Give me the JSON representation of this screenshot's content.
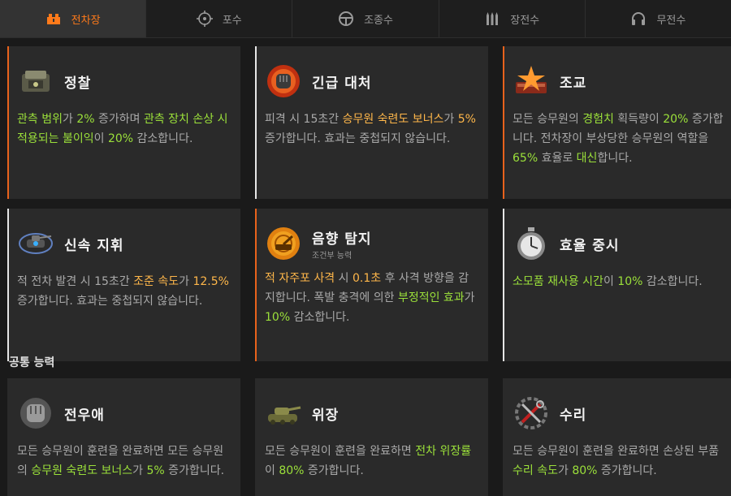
{
  "tabs": [
    {
      "label": "전차장",
      "icon": "commander-icon",
      "active": true
    },
    {
      "label": "포수",
      "icon": "crosshair-icon",
      "active": false
    },
    {
      "label": "조종수",
      "icon": "steering-wheel-icon",
      "active": false
    },
    {
      "label": "장전수",
      "icon": "shells-icon",
      "active": false
    },
    {
      "label": "무전수",
      "icon": "headset-icon",
      "active": false
    }
  ],
  "skills": [
    {
      "title": "정찰",
      "icon": "recon-icon",
      "desc": [
        [
          "관측 범위",
          "g"
        ],
        [
          "가 ",
          ""
        ],
        [
          "2%",
          "g"
        ],
        [
          " 증가하며 ",
          ""
        ],
        [
          "관측 장치 손상 시 적용되는 불이익",
          "g"
        ],
        [
          "이 ",
          ""
        ],
        [
          "20%",
          "g"
        ],
        [
          " 감소합니다.",
          ""
        ]
      ]
    },
    {
      "title": "긴급 대처",
      "icon": "emergency-fist-icon",
      "desc": [
        [
          "피격 시 15초간 ",
          ""
        ],
        [
          "승무원 숙련도 보너스",
          "o"
        ],
        [
          "가 ",
          ""
        ],
        [
          "5%",
          "o"
        ],
        [
          " 증가합니다. 효과는 중첩되지 않습니다.",
          ""
        ]
      ]
    },
    {
      "title": "조교",
      "icon": "mentor-star-icon",
      "desc": [
        [
          "모든 승무원의 ",
          ""
        ],
        [
          "경험치",
          "g"
        ],
        [
          " 획득량이 ",
          ""
        ],
        [
          "20%",
          "g"
        ],
        [
          " 증가합니다. 전차장이 부상당한 승무원의 역할을 ",
          ""
        ],
        [
          "65%",
          "g"
        ],
        [
          " 효율로 ",
          ""
        ],
        [
          "대신",
          "g"
        ],
        [
          "합니다.",
          ""
        ]
      ]
    },
    {
      "title": "신속 지휘",
      "icon": "tank-radar-icon",
      "desc": [
        [
          "적 전차 발견 시 15초간 ",
          ""
        ],
        [
          "조준 속도",
          "o"
        ],
        [
          "가 ",
          ""
        ],
        [
          "12.5%",
          "o"
        ],
        [
          " 증가합니다. 효과는 중첩되지 않습니다.",
          ""
        ]
      ]
    },
    {
      "title": "음향 탐지",
      "subtitle": "조건부 능력",
      "icon": "sound-radar-icon",
      "desc": [
        [
          "적 자주포 사격",
          "o"
        ],
        [
          " 시 ",
          ""
        ],
        [
          "0.1초",
          "o"
        ],
        [
          " 후 사격 방향을 감지합니다. 폭발 충격에 의한 ",
          ""
        ],
        [
          "부정적인 효과",
          "g"
        ],
        [
          "가 ",
          ""
        ],
        [
          "10%",
          "g"
        ],
        [
          " 감소합니다.",
          ""
        ]
      ]
    },
    {
      "title": "효율 중시",
      "icon": "stopwatch-icon",
      "desc": [
        [
          "소모품 재사용 시간",
          "g"
        ],
        [
          "이 ",
          ""
        ],
        [
          "10%",
          "g"
        ],
        [
          " 감소합니다.",
          ""
        ]
      ]
    }
  ],
  "section_title": "공통 능력",
  "common": [
    {
      "title": "전우애",
      "icon": "brotherhood-fist-icon",
      "desc": [
        [
          "모든 승무원이 훈련을 완료하면 모든 승무원의 ",
          ""
        ],
        [
          "승무원 숙련도 보너스",
          "g"
        ],
        [
          "가 ",
          ""
        ],
        [
          "5%",
          "g"
        ],
        [
          " 증가합니다.",
          ""
        ]
      ]
    },
    {
      "title": "위장",
      "icon": "camo-tank-icon",
      "desc": [
        [
          "모든 승무원이 훈련을 완료하면 ",
          ""
        ],
        [
          "전차 위장률",
          "g"
        ],
        [
          "이 ",
          ""
        ],
        [
          "80%",
          "g"
        ],
        [
          " 증가합니다.",
          ""
        ]
      ]
    },
    {
      "title": "수리",
      "icon": "repair-tools-icon",
      "desc": [
        [
          "모든 승무원이 훈련을 완료하면 손상된 부품 ",
          ""
        ],
        [
          "수리 속도",
          "g"
        ],
        [
          "가 ",
          ""
        ],
        [
          "80%",
          "g"
        ],
        [
          " 증가합니다.",
          ""
        ]
      ]
    }
  ]
}
